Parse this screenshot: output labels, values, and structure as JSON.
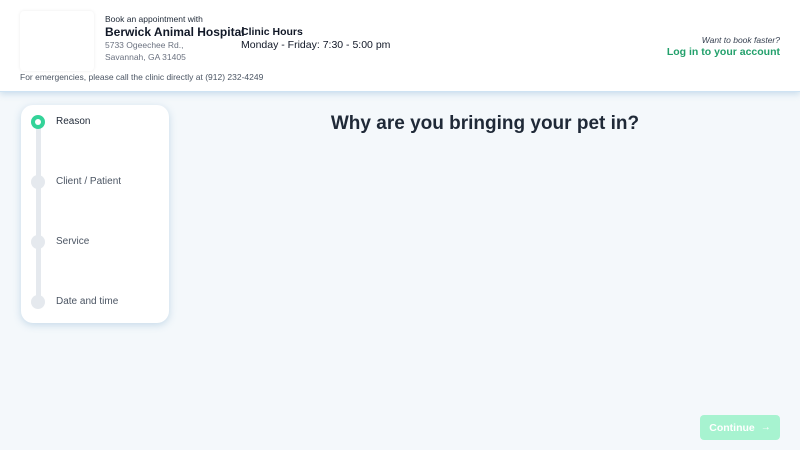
{
  "header": {
    "book_with": "Book an appointment with",
    "hospital_name": "Berwick Animal Hospital",
    "address_line1": "5733 Ogeechee Rd.,",
    "address_line2": "Savannah, GA 31405",
    "hours_title": "Clinic Hours",
    "hours_value": "Monday - Friday: 7:30 - 5:00 pm",
    "emergency_note": "For emergencies, please call the clinic directly at (912) 232-4249",
    "faster_prompt": "Want to book faster?",
    "login_label": "Log in to your account"
  },
  "steps": [
    {
      "label": "Reason",
      "active": true
    },
    {
      "label": "Client / Patient",
      "active": false
    },
    {
      "label": "Service",
      "active": false
    },
    {
      "label": "Date and time",
      "active": false
    }
  ],
  "main": {
    "question": "Why are you bringing your pet in?"
  },
  "footer": {
    "continue_label": "Continue",
    "continue_icon": "arrow-right-icon"
  },
  "colors": {
    "accent": "#22a06b",
    "active_step": "#34d399",
    "button_disabled": "#a7f3d0",
    "background": "#f4f8fb"
  }
}
